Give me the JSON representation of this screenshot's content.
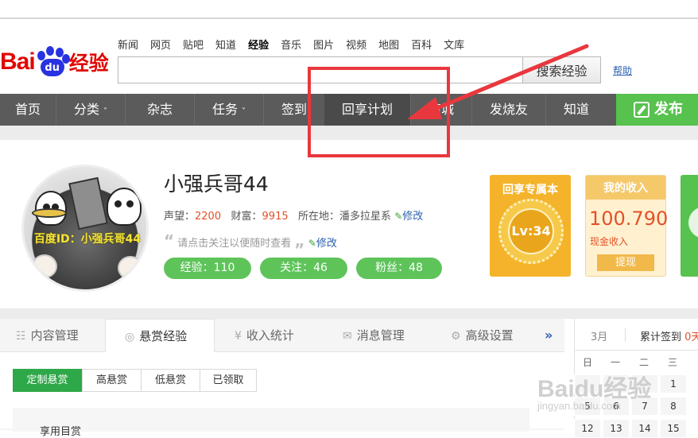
{
  "logo": {
    "brand_latin": "Bai",
    "brand_du": "du",
    "brand_cn": "经验"
  },
  "top_nav": [
    "新闻",
    "网页",
    "贴吧",
    "知道",
    "经验",
    "音乐",
    "图片",
    "视频",
    "地图",
    "百科",
    "文库"
  ],
  "top_nav_active": "经验",
  "search": {
    "value": "",
    "button": "搜索经验",
    "help": "帮助"
  },
  "main_nav": {
    "items": [
      "首页",
      "分类",
      "杂志",
      "任务",
      "签到",
      "回享计划",
      "商城",
      "发烧友",
      "知道"
    ],
    "highlighted": "回享计划",
    "publish": "发布"
  },
  "profile": {
    "name": "小强兵哥44",
    "reputation_label": "声望：",
    "reputation": "2200",
    "wealth_label": "财富：",
    "wealth": "9915",
    "location_label": "所在地：",
    "location": "潘多拉星系",
    "edit": "修改",
    "tagline": "请点击关注以便随时查看",
    "avatar_caption": "百度ID：小强兵哥44",
    "pills": [
      "经验：110",
      "关注：46",
      "粉丝：48"
    ]
  },
  "cards": {
    "level_title": "回享专属本",
    "level": "Lv:34",
    "income_title": "我的收入",
    "income_amount": "100.790",
    "income_label": "现金收入",
    "withdraw": "提现"
  },
  "tabs": [
    "内容管理",
    "悬赏经验",
    "收入统计",
    "消息管理",
    "高级设置"
  ],
  "tab_icons": [
    "list-icon",
    "coin-icon",
    "yen-icon",
    "mail-icon",
    "gear-icon"
  ],
  "active_tab": "悬赏经验",
  "more": "»",
  "subtabs": [
    "定制悬赏",
    "高悬赏",
    "低悬赏",
    "已领取"
  ],
  "active_subtab": "定制悬赏",
  "list_label": "享用目赏",
  "calendar": {
    "month": "3月",
    "signin_label": "累计签到",
    "signin_value": "0天",
    "weekdays": [
      "日",
      "一",
      "二",
      "三"
    ],
    "rows": [
      [
        "",
        "",
        "",
        "1"
      ],
      [
        "5",
        "6",
        "7",
        "8"
      ],
      [
        "12",
        "13",
        "14",
        "15"
      ]
    ]
  },
  "watermark": {
    "main": "Baidu经验",
    "sub": "jingyan.baidu.com"
  },
  "colors": {
    "brand_red": "#e10601",
    "brand_blue": "#2932e1",
    "nav_bg": "#5b5b5b",
    "green": "#57c24e",
    "annotation_red": "#e8383d"
  }
}
